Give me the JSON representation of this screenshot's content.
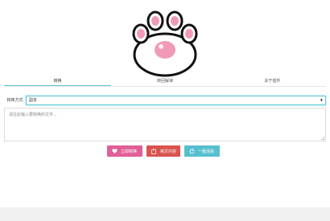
{
  "tabs": [
    {
      "label": "转换"
    },
    {
      "label": "转回解读"
    },
    {
      "label": "关于插件"
    }
  ],
  "mode": {
    "label": "转换方式",
    "selected": "副本"
  },
  "textarea": {
    "placeholder": "请在此输入要转换的文字..."
  },
  "buttons": {
    "convert": "立即转换",
    "copy": "拷贝内容",
    "clear": "一键清除"
  },
  "colors": {
    "accent": "#5bc8d8",
    "convert": "#e15e98",
    "copy": "#d9534f",
    "clear": "#56bfcf"
  }
}
